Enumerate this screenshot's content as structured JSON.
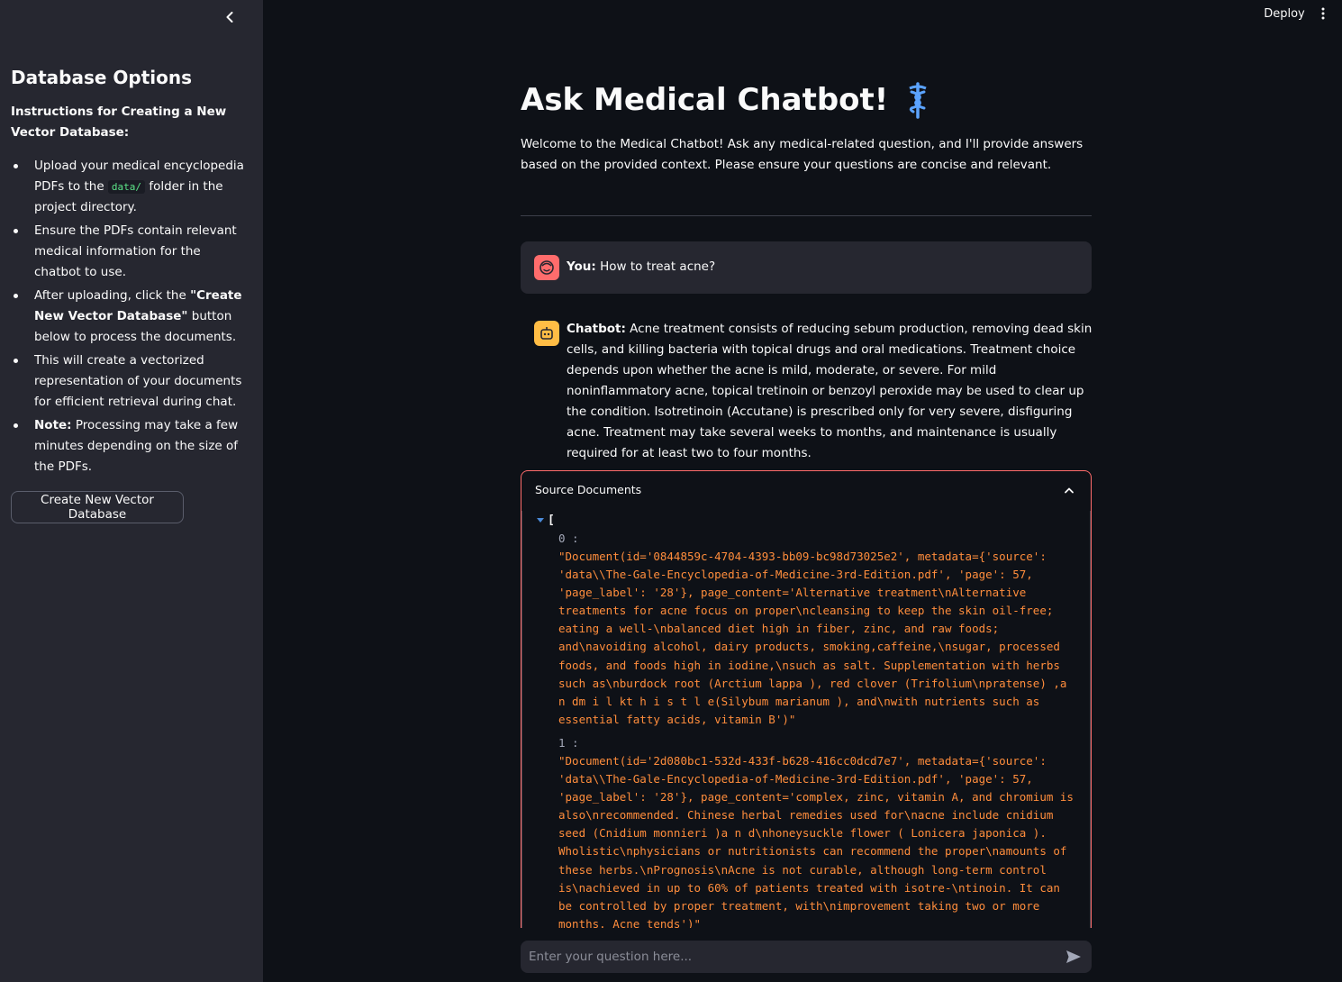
{
  "header": {
    "deploy_label": "Deploy"
  },
  "sidebar": {
    "title": "Database Options",
    "instructions_heading": "Instructions for Creating a New Vector Database:",
    "items": [
      {
        "prefix": "Upload your medical encyclopedia PDFs to the ",
        "code": "data/",
        "suffix": " folder in the project directory."
      },
      {
        "text": "Ensure the PDFs contain relevant medical information for the chatbot to use."
      },
      {
        "prefix": "After uploading, click the ",
        "strong": "\"Create New Vector Database\"",
        "suffix": " button below to process the documents."
      },
      {
        "text": "This will create a vectorized representation of your documents for efficient retrieval during chat."
      },
      {
        "strong": "Note:",
        "suffix": " Processing may take a few minutes depending on the size of the PDFs."
      }
    ],
    "create_button_label": "Create New Vector Database"
  },
  "main": {
    "title": "Ask Medical Chatbot!",
    "intro": "Welcome to the Medical Chatbot! Ask any medical-related question, and I'll provide answers based on the provided context. Please ensure your questions are concise and relevant."
  },
  "chat": {
    "user": {
      "speaker": "You:",
      "text": " How to treat acne?"
    },
    "bot": {
      "speaker": "Chatbot:",
      "text": " Acne treatment consists of reducing sebum production, removing dead skin cells, and killing bacteria with topical drugs and oral medications. Treatment choice depends upon whether the acne is mild, moderate, or severe. For mild noninflammatory acne, topical tretinoin or benzoyl peroxide may be used to clear up the condition. Isotretinoin (Accutane) is prescribed only for very severe, disfiguring acne. Treatment may take several weeks to months, and maintenance is usually required for at least two to four months."
    }
  },
  "sources": {
    "label": "Source Documents",
    "bracket": "[",
    "items": [
      {
        "index": "0 :",
        "value": "\"Document(id='0844859c-4704-4393-bb09-bc98d73025e2', metadata={'source': 'data\\\\The-Gale-Encyclopedia-of-Medicine-3rd-Edition.pdf', 'page': 57, 'page_label': '28'}, page_content='Alternative treatment\\nAlternative treatments for acne focus on proper\\ncleansing to keep the skin oil-free; eating a well-\\nbalanced diet high in fiber, zinc, and raw foods; and\\navoiding alcohol, dairy products, smoking,caffeine,\\nsugar, processed foods, and foods high in iodine,\\nsuch as salt. Supplementation with herbs such as\\nburdock root (Arctium lappa ), red clover (Trifolium\\npratense) ,a n dm i l kt h i s t l e(Silybum marianum ), and\\nwith nutrients such as essential fatty acids, vitamin B')\""
      },
      {
        "index": "1 :",
        "value": "\"Document(id='2d080bc1-532d-433f-b628-416cc0dcd7e7', metadata={'source': 'data\\\\The-Gale-Encyclopedia-of-Medicine-3rd-Edition.pdf', 'page': 57, 'page_label': '28'}, page_content='complex, zinc, vitamin A, and chromium is also\\nrecommended. Chinese herbal remedies used for\\nacne include cnidium seed (Cnidium monnieri )a n d\\nhoneysuckle flower ( Lonicera japonica ). Wholistic\\nphysicians or nutritionists can recommend the proper\\namounts of these herbs.\\nPrognosis\\nAcne is not curable, although long-term control is\\nachieved in up to 60% of patients treated with isotre-\\ntinoin. It can be controlled by proper treatment, with\\nimprovement taking two or more months. Acne tends')\""
      }
    ]
  },
  "input": {
    "placeholder": "Enter your question here..."
  },
  "colors": {
    "accent": "#ff6c6c",
    "code_text": "#ff8d3c",
    "bot_avatar": "#ffbd45",
    "sidebar_bg": "#262730",
    "main_bg": "#0e1117"
  }
}
